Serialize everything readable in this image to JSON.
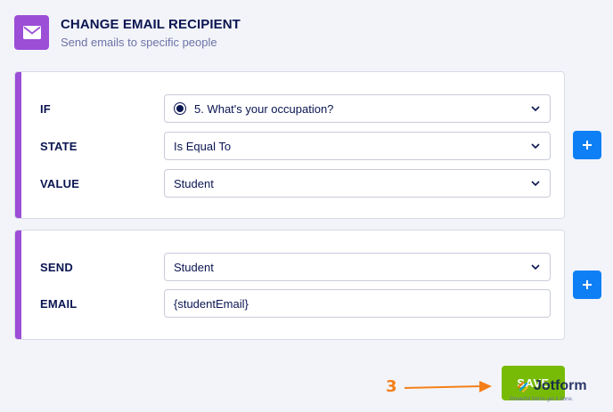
{
  "header": {
    "title": "CHANGE EMAIL RECIPIENT",
    "subtitle": "Send emails to specific people",
    "icon": "envelope-icon",
    "icon_bg": "#9c4ed6"
  },
  "condition": {
    "if_label": "IF",
    "if_value": "5. What's your occupation?",
    "state_label": "STATE",
    "state_value": "Is Equal To",
    "value_label": "VALUE",
    "value_value": "Student"
  },
  "action": {
    "send_label": "SEND",
    "send_value": "Student",
    "email_label": "EMAIL",
    "email_value": "{studentEmail}"
  },
  "buttons": {
    "add_condition": "+",
    "add_action": "+",
    "save": "SAVE"
  },
  "annotation": {
    "step": "3",
    "color": "#f47f18"
  },
  "watermark": {
    "name": "Jotform",
    "tagline": "Powerful forms get it done."
  },
  "colors": {
    "accent_purple": "#9c4ed6",
    "primary_blue": "#0f7ff5",
    "save_green": "#78bb07",
    "text_navy": "#0a1551"
  }
}
